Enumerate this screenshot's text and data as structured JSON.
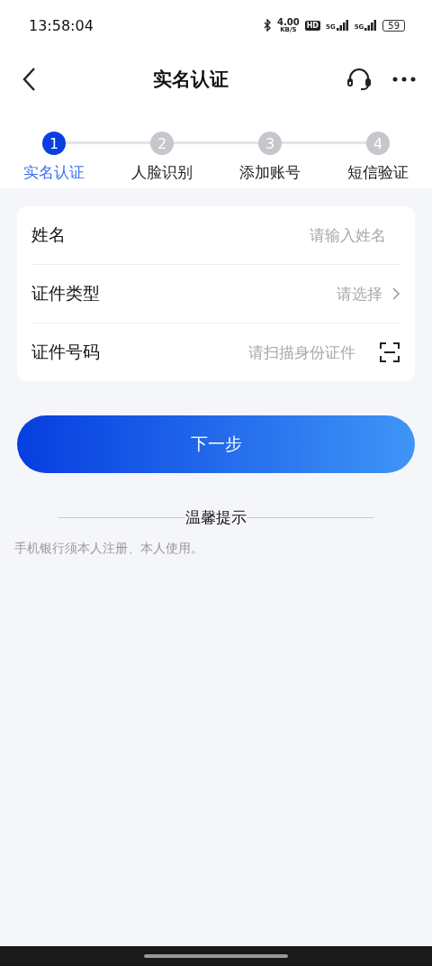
{
  "status_bar": {
    "time": "13:58:04",
    "speed": "4.00",
    "speed_unit": "KB/S",
    "hd": "HD",
    "sim1": "5G",
    "sim2": "5G",
    "battery": "59"
  },
  "header": {
    "title": "实名认证"
  },
  "steps": [
    {
      "number": "1",
      "label": "实名认证",
      "selected": true
    },
    {
      "number": "2",
      "label": "人脸识别",
      "selected": false
    },
    {
      "number": "3",
      "label": "添加账号",
      "selected": false
    },
    {
      "number": "4",
      "label": "短信验证",
      "selected": false
    }
  ],
  "form": [
    {
      "kind": "text",
      "label": "姓名",
      "placeholder": "请输入姓名"
    },
    {
      "kind": "select",
      "label": "证件类型",
      "placeholder": "请选择"
    },
    {
      "kind": "scan",
      "label": "证件号码",
      "placeholder": "请扫描身份证件"
    }
  ],
  "next_button": "下一步",
  "tips": {
    "title": "温馨提示",
    "text": "手机银行须本人注册、本人使用。"
  }
}
